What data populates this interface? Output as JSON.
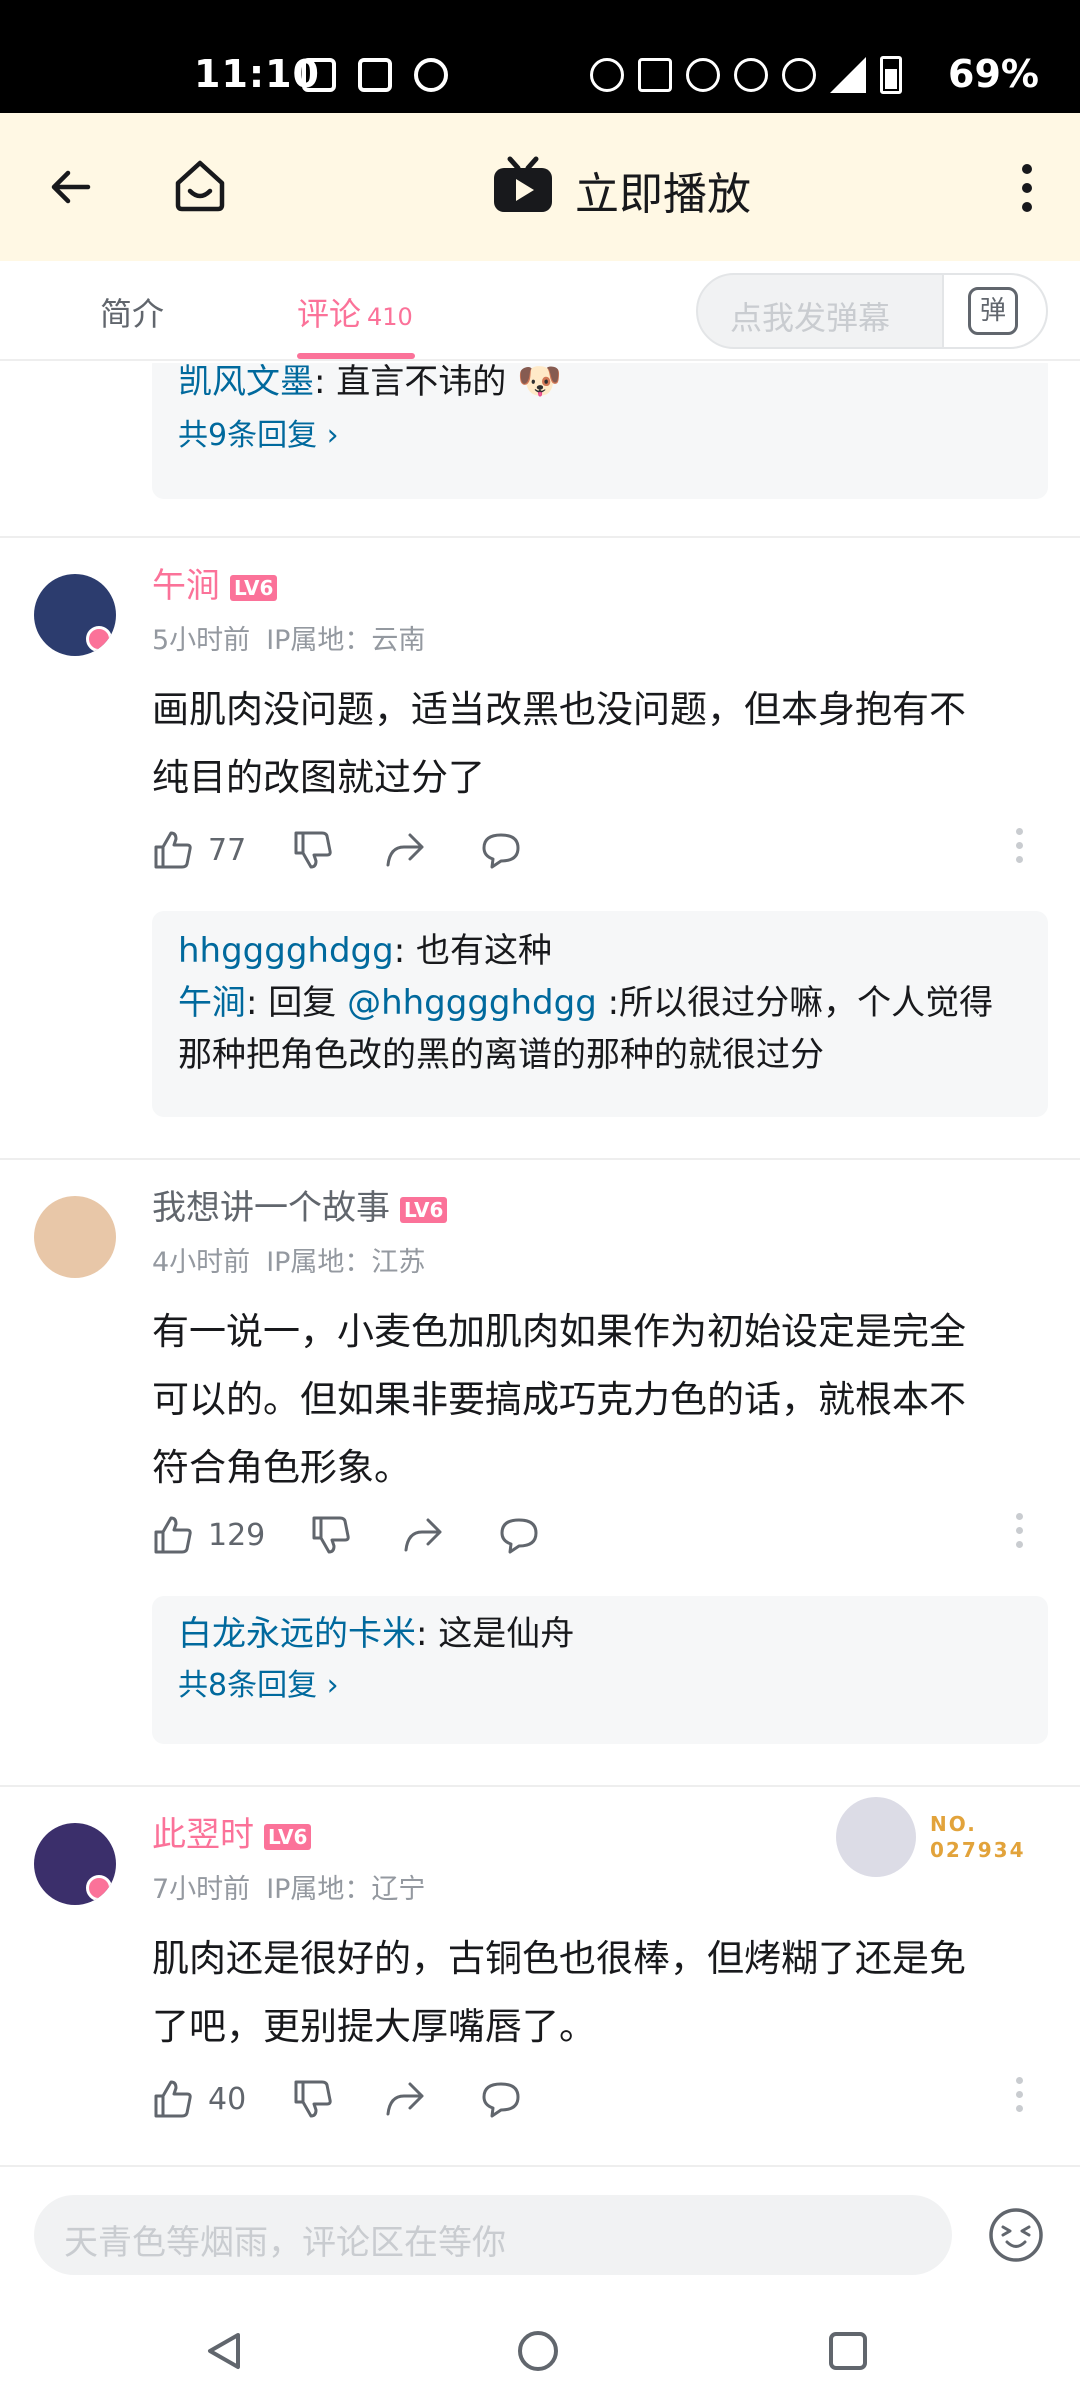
{
  "status_bar": {
    "time": "11:10",
    "battery": "69%"
  },
  "appbar": {
    "play_label": "立即播放"
  },
  "tabs": {
    "intro": "简介",
    "comments": "评论",
    "comments_count": "410",
    "danmaku_placeholder": "点我发弹幕",
    "danmaku_button": "弹"
  },
  "top_reply": {
    "user": "凯风文墨",
    "text": ": 直言不讳的",
    "emoji": "🐶",
    "more": "共9条回复 ›"
  },
  "comments": [
    {
      "user": "午涧",
      "level": "LV6",
      "time": "5小时前",
      "ip": "IP属地：云南",
      "text_lines": [
        "画肌肉没问题，适当改黑也没问题，但本身抱有不",
        "纯目的改图就过分了"
      ],
      "likes": "77",
      "replies": [
        {
          "user": "hhgggghdgg",
          "text": ": 也有这种"
        },
        {
          "user": "午涧",
          "text": ": 回复 ",
          "mention": "@hhgggghdgg",
          "tail_line1": " :所以很过分嘛，个人觉得",
          "tail_line2": "那种把角色改的黑的离谱的那种的就很过分"
        }
      ]
    },
    {
      "user": "我想讲一个故事",
      "level": "LV6",
      "time": "4小时前",
      "ip": "IP属地：江苏",
      "text_lines": [
        "有一说一，小麦色加肌肉如果作为初始设定是完全",
        "可以的。但如果非要搞成巧克力色的话，就根本不",
        "符合角色形象。"
      ],
      "likes": "129",
      "replies": [
        {
          "user": "白龙永远的卡米",
          "text": ": 这是仙舟"
        }
      ],
      "more": "共8条回复 ›"
    },
    {
      "user": "此翌时",
      "level": "LV6",
      "time": "7小时前",
      "ip": "IP属地：辽宁",
      "text_lines": [
        "肌肉还是很好的，古铜色也很棒，但烤糊了还是免",
        "了吧，更别提大厚嘴唇了。"
      ],
      "likes": "40",
      "fan_no_line1": "NO.",
      "fan_no_line2": "027934"
    }
  ],
  "bottom_input": {
    "placeholder": "天青色等烟雨，评论区在等你"
  },
  "colors": {
    "accent": "#fb7299",
    "link": "#00699d",
    "appbar_bg": "#fff8e4"
  }
}
